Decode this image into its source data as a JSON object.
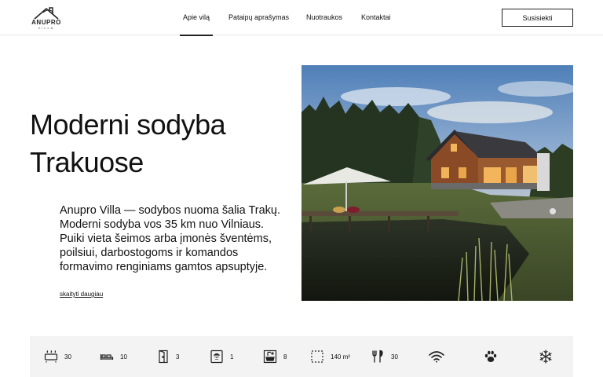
{
  "brand": {
    "name": "ANUPRO",
    "sub": "VILLA"
  },
  "nav": {
    "items": [
      {
        "label": "Apie vilą",
        "active": true
      },
      {
        "label": "Pataipų aprašymas",
        "active": false
      },
      {
        "label": "Nuotraukos",
        "active": false
      },
      {
        "label": "Kontaktai",
        "active": false
      }
    ],
    "cta": "Susisiekti"
  },
  "hero": {
    "title_line1": "Moderni sodyba",
    "title_line2": "Trakuose",
    "description": "Anupro Villa — sodybos nuoma šalia Trakų. Moderni sodyba vos 35 km nuo Vilniaus. Puiki vieta šeimos arba įmonės šventėms, poilsiui, darbostogoms ir komandos formavimo renginiams gamtos apsuptyje.",
    "link": "skaityti daugiau"
  },
  "amenities": [
    {
      "icon": "sauna-heater-icon",
      "value": "30"
    },
    {
      "icon": "bed-icon",
      "value": "10"
    },
    {
      "icon": "door-icon",
      "value": "3"
    },
    {
      "icon": "shower-icon",
      "value": "1"
    },
    {
      "icon": "bath-icon",
      "value": "8"
    },
    {
      "icon": "area-icon",
      "value": "140 m²"
    },
    {
      "icon": "cutlery-icon",
      "value": "30"
    },
    {
      "icon": "wifi-icon",
      "value": ""
    },
    {
      "icon": "paw-icon",
      "value": ""
    },
    {
      "icon": "snowflake-icon",
      "value": ""
    }
  ]
}
